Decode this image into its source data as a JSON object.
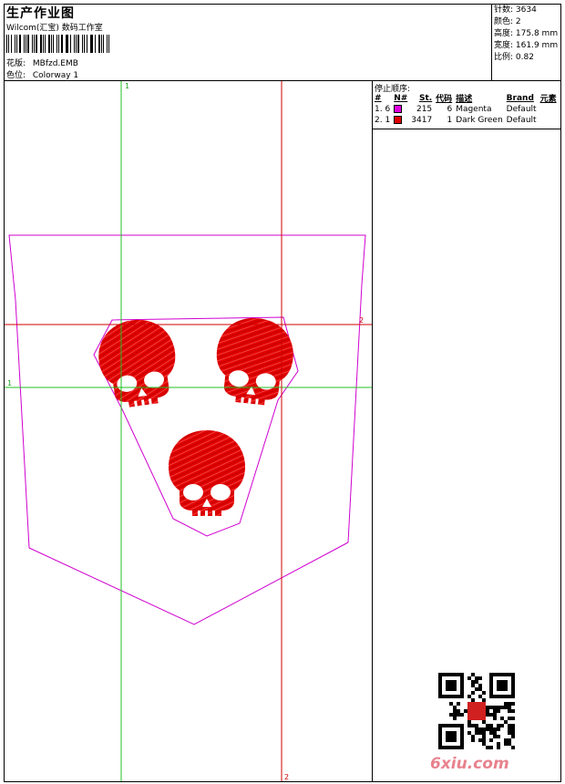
{
  "header": {
    "title": "生产作业图",
    "studio": "Wilcom(汇宝) 数码工作室",
    "design_label": "花版:",
    "design_value": "MBfzd.EMB",
    "colorway_label": "色位:",
    "colorway_value": "Colorway 1"
  },
  "stats": [
    {
      "label": "针数:",
      "value": "3634"
    },
    {
      "label": "颜色:",
      "value": "2"
    },
    {
      "label": "高度:",
      "value": "175.8 mm"
    },
    {
      "label": "宽度:",
      "value": "161.9 mm"
    },
    {
      "label": "比例:",
      "value": "0.82"
    }
  ],
  "stop_sequence": {
    "title": "停止顺序:",
    "headers": [
      "#",
      "N#",
      "St.",
      "代码",
      "描述",
      "Brand",
      "元素"
    ],
    "rows": [
      {
        "index": "1. 6",
        "color": "#e000e0",
        "st": "215",
        "code": "6",
        "desc": "Magenta",
        "brand": "Default"
      },
      {
        "index": "2. 1",
        "color": "#e00000",
        "st": "3417",
        "code": "1",
        "desc": "Dark Green",
        "brand": "Default"
      }
    ]
  },
  "guides": {
    "green_label": "1",
    "red_label": "2"
  },
  "watermark": "6xiu.com",
  "colors": {
    "outline": "#d000d0",
    "embroidery": "#e00000",
    "guide_green": "#20c020",
    "guide_red": "#d00000"
  }
}
